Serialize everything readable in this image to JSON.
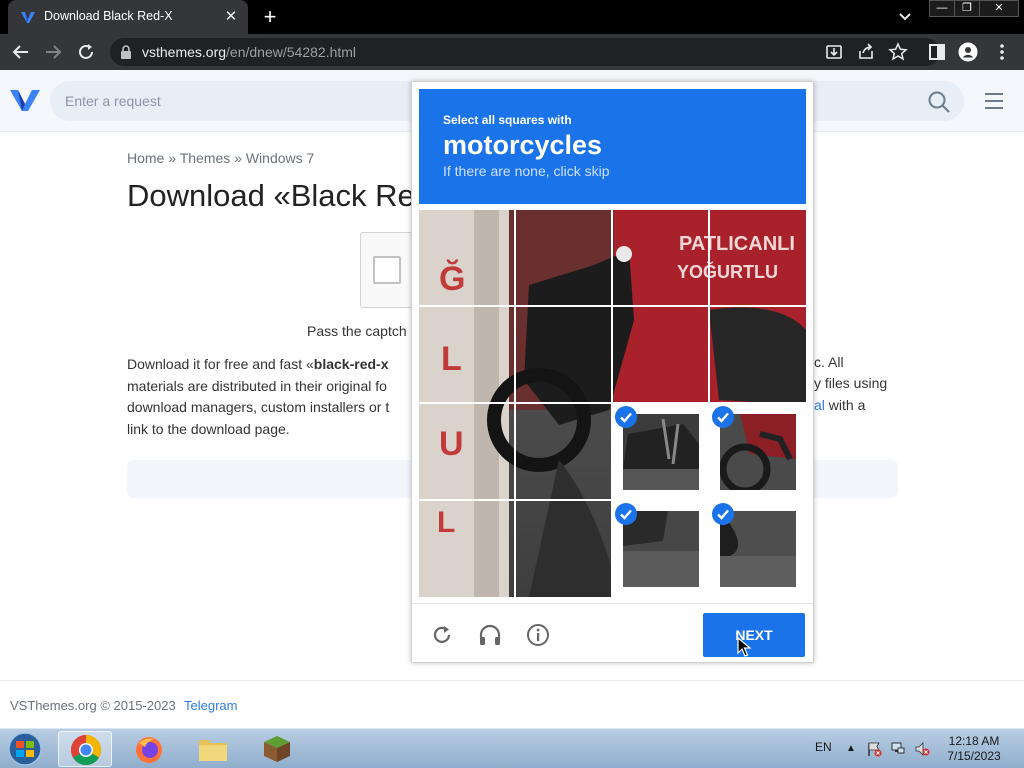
{
  "browser": {
    "tab_title": "Download Black Red-X",
    "tab_close": "✕",
    "new_tab": "+",
    "url_host": "vsthemes.org",
    "url_path": "/en/dnew/54282.html",
    "window_buttons": [
      "—",
      "❐",
      "✕"
    ]
  },
  "site": {
    "search_placeholder": "Enter a request",
    "breadcrumb": [
      "Home",
      "Themes",
      "Windows 7"
    ],
    "breadcrumb_sep": "»",
    "title": "Download «Black Re",
    "pass_text": "Pass the captch",
    "desc_line1_pre": "Download it for free and fast «",
    "desc_line1_bold": "black-red-x",
    "desc_line2": "materials are distributed in their original fo",
    "desc_line3": "download managers, custom installers or t",
    "desc_line4": "link to the download page.",
    "desc_right1": "c. All",
    "desc_right2": "y files using",
    "desc_right3_link": "al",
    "desc_right3_rest": " with a",
    "footer_copyright": "VSThemes.org © 2015-2023",
    "footer_link": "Telegram"
  },
  "recaptcha": {
    "instruction": "Select all squares with",
    "object": "motorcycles",
    "hint": "If there are none, click skip",
    "next_label": "NEXT",
    "selected_tiles": [
      10,
      11,
      14,
      15
    ]
  },
  "taskbar": {
    "language": "EN",
    "tray_arrow": "▲",
    "time": "12:18 AM",
    "date": "7/15/2023"
  },
  "colors": {
    "recaptcha_blue": "#1a73e8",
    "link_blue": "#2d7be5",
    "chrome_dark": "#35363a"
  }
}
